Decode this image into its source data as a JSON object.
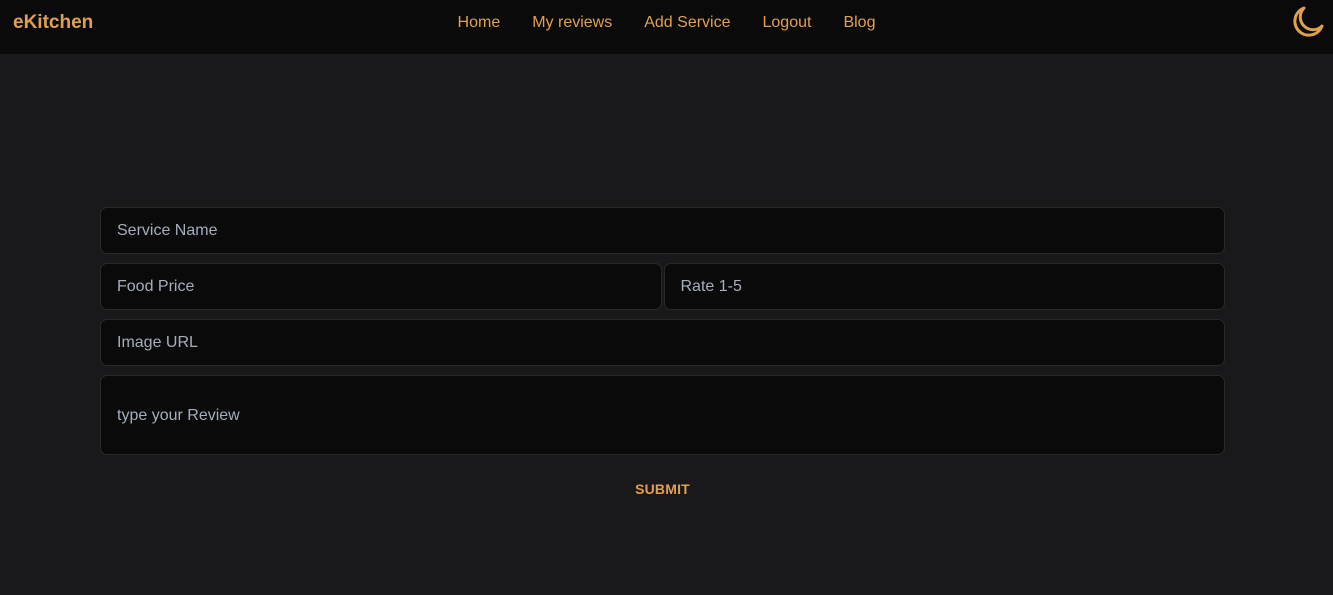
{
  "header": {
    "brand": "eKitchen",
    "nav": [
      {
        "label": "Home"
      },
      {
        "label": "My reviews"
      },
      {
        "label": "Add Service"
      },
      {
        "label": "Logout"
      },
      {
        "label": "Blog"
      }
    ],
    "theme_icon": "moon-icon"
  },
  "form": {
    "service_name": {
      "placeholder": "Service Name",
      "value": ""
    },
    "food_price": {
      "placeholder": "Food Price",
      "value": ""
    },
    "rate": {
      "placeholder": "Rate 1-5",
      "value": ""
    },
    "image_url": {
      "placeholder": "Image URL",
      "value": ""
    },
    "review": {
      "placeholder": "type your Review",
      "value": ""
    },
    "submit_label": "SUBMIT"
  },
  "colors": {
    "accent": "#e0a050",
    "background": "#19191b",
    "navbar": "#0a0a0b",
    "input_bg": "#0a0a0b",
    "input_text": "#a6adbb"
  }
}
